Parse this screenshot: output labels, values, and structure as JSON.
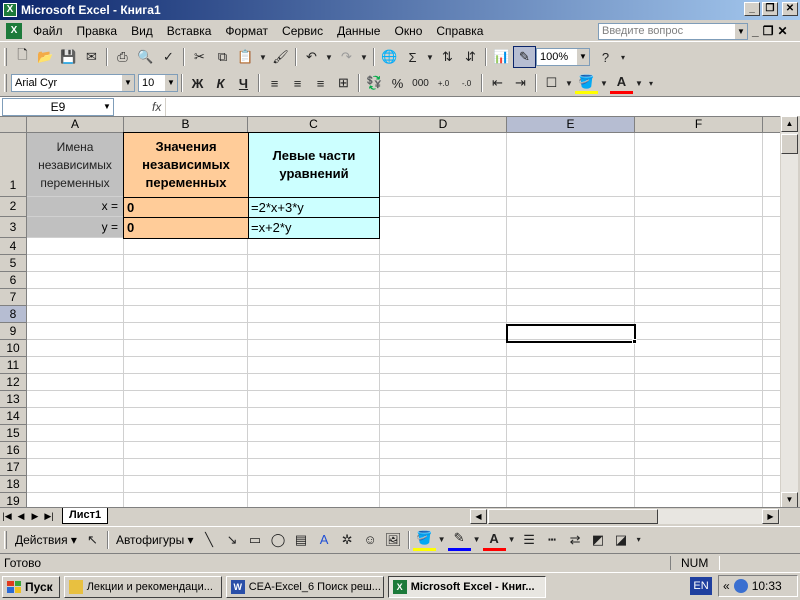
{
  "window": {
    "title": "Microsoft Excel - Книга1"
  },
  "menu": {
    "items": [
      "Файл",
      "Правка",
      "Вид",
      "Вставка",
      "Формат",
      "Сервис",
      "Данные",
      "Окно",
      "Справка"
    ],
    "ask_placeholder": "Введите вопрос"
  },
  "toolbar": {
    "zoom": "100%",
    "font_name": "Arial Cyr",
    "font_size": "10",
    "bold": "Ж",
    "italic": "К",
    "underline": "Ч",
    "percent": "%",
    "thousands": "000",
    "inc_decimal": ",0⁠,00",
    "dec_decimal": ",00⁠,0"
  },
  "formula_bar": {
    "name_box": "E9",
    "fx": "fx",
    "content": ""
  },
  "columns": [
    "A",
    "B",
    "C",
    "D",
    "E",
    "F"
  ],
  "rows": [
    "1",
    "2",
    "3",
    "4",
    "5",
    "6",
    "7",
    "8",
    "9",
    "10",
    "11",
    "12",
    "13",
    "14",
    "15",
    "16",
    "17",
    "18",
    "19"
  ],
  "cells": {
    "a1": "Имена независимых переменных",
    "b1": "Значения независимых переменных",
    "c1": "Левые части уравнений",
    "a2": "x =",
    "b2": "0",
    "c2": "=2*x+3*y",
    "a3": "y =",
    "b3": "0",
    "c3": "=x+2*y"
  },
  "sheet_tab": "Лист1",
  "drawing": {
    "actions": "Действия",
    "autoshapes": "Автофигуры"
  },
  "status": {
    "text": "Готово",
    "num": "NUM"
  },
  "taskbar": {
    "start": "Пуск",
    "tasks": [
      "Лекции и рекомендаци...",
      "CEA-Excel_6 Поиск реш...",
      "Microsoft Excel - Книг..."
    ],
    "lang": "EN",
    "time": "10:33"
  }
}
